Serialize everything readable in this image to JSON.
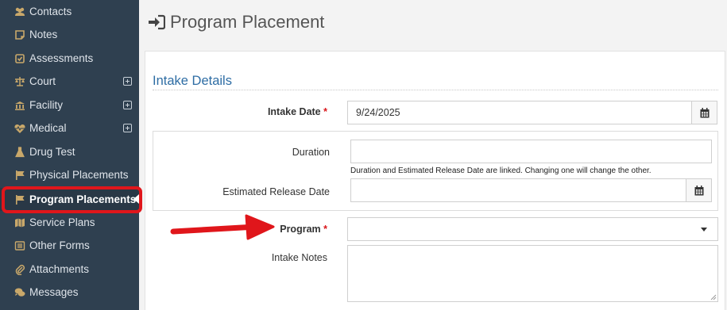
{
  "sidebar": {
    "items": [
      {
        "label": "Contacts",
        "icon": "users-icon"
      },
      {
        "label": "Notes",
        "icon": "note-icon"
      },
      {
        "label": "Assessments",
        "icon": "check-square-icon"
      },
      {
        "label": "Court",
        "icon": "scale-icon",
        "expandable": true
      },
      {
        "label": "Facility",
        "icon": "bank-icon",
        "expandable": true
      },
      {
        "label": "Medical",
        "icon": "heartbeat-icon",
        "expandable": true
      },
      {
        "label": "Drug Test",
        "icon": "flask-icon"
      },
      {
        "label": "Physical Placements",
        "icon": "flag-icon"
      },
      {
        "label": "Program Placements",
        "icon": "flag-icon",
        "active": true
      },
      {
        "label": "Service Plans",
        "icon": "map-icon"
      },
      {
        "label": "Other Forms",
        "icon": "list-icon"
      },
      {
        "label": "Attachments",
        "icon": "paperclip-icon"
      },
      {
        "label": "Messages",
        "icon": "comments-icon"
      }
    ]
  },
  "header": {
    "title": "Program Placement",
    "icon": "sign-in-icon"
  },
  "form": {
    "section_title": "Intake Details",
    "intake_date": {
      "label": "Intake Date",
      "required_mark": "*",
      "value": "9/24/2025"
    },
    "duration": {
      "label": "Duration",
      "value": ""
    },
    "linked_help": "Duration and Estimated Release Date are linked. Changing one will change the other.",
    "estimated_release_date": {
      "label": "Estimated Release Date",
      "value": ""
    },
    "program": {
      "label": "Program",
      "required_mark": "*",
      "value": ""
    },
    "intake_notes": {
      "label": "Intake Notes",
      "value": ""
    }
  },
  "colors": {
    "sidebar_bg": "#2f4050",
    "accent_blue": "#2e6da4",
    "annotation_red": "#e0161b"
  }
}
